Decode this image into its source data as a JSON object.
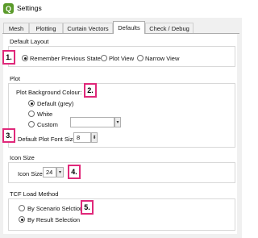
{
  "window": {
    "title": "Settings",
    "icon": "qgis-app-icon"
  },
  "tabs": [
    {
      "label": "Mesh",
      "active": false
    },
    {
      "label": "Plotting",
      "active": false
    },
    {
      "label": "Curtain Vectors",
      "active": false
    },
    {
      "label": "Defaults",
      "active": true
    },
    {
      "label": "Check / Debug",
      "active": false
    }
  ],
  "default_layout": {
    "title": "Default Layout",
    "options": [
      {
        "label": "Remember Previous State",
        "checked": true
      },
      {
        "label": "Plot View",
        "checked": false
      },
      {
        "label": "Narrow View",
        "checked": false
      }
    ]
  },
  "plot": {
    "title": "Plot",
    "background_colour_label": "Plot Background Colour:",
    "colour_options": [
      {
        "label": "Default (grey)",
        "checked": true
      },
      {
        "label": "White",
        "checked": false
      },
      {
        "label": "Custom",
        "checked": false
      }
    ],
    "custom_colour_value": "",
    "font_size_label": "Default Plot Font Size",
    "font_size_value": "8"
  },
  "icon_size": {
    "title": "Icon Size",
    "label": "Icon Size",
    "value": "24"
  },
  "tcf_load": {
    "title": "TCF Load Method",
    "options": [
      {
        "label": "By Scenario Selction",
        "checked": false
      },
      {
        "label": "By Result Selection",
        "checked": true
      }
    ]
  },
  "markers": [
    "1.",
    "2.",
    "3.",
    "4.",
    "5."
  ],
  "colors": {
    "marker_border": "#e0287a",
    "window_bg": "#f0f0f0",
    "page_bg": "#ffffff"
  }
}
